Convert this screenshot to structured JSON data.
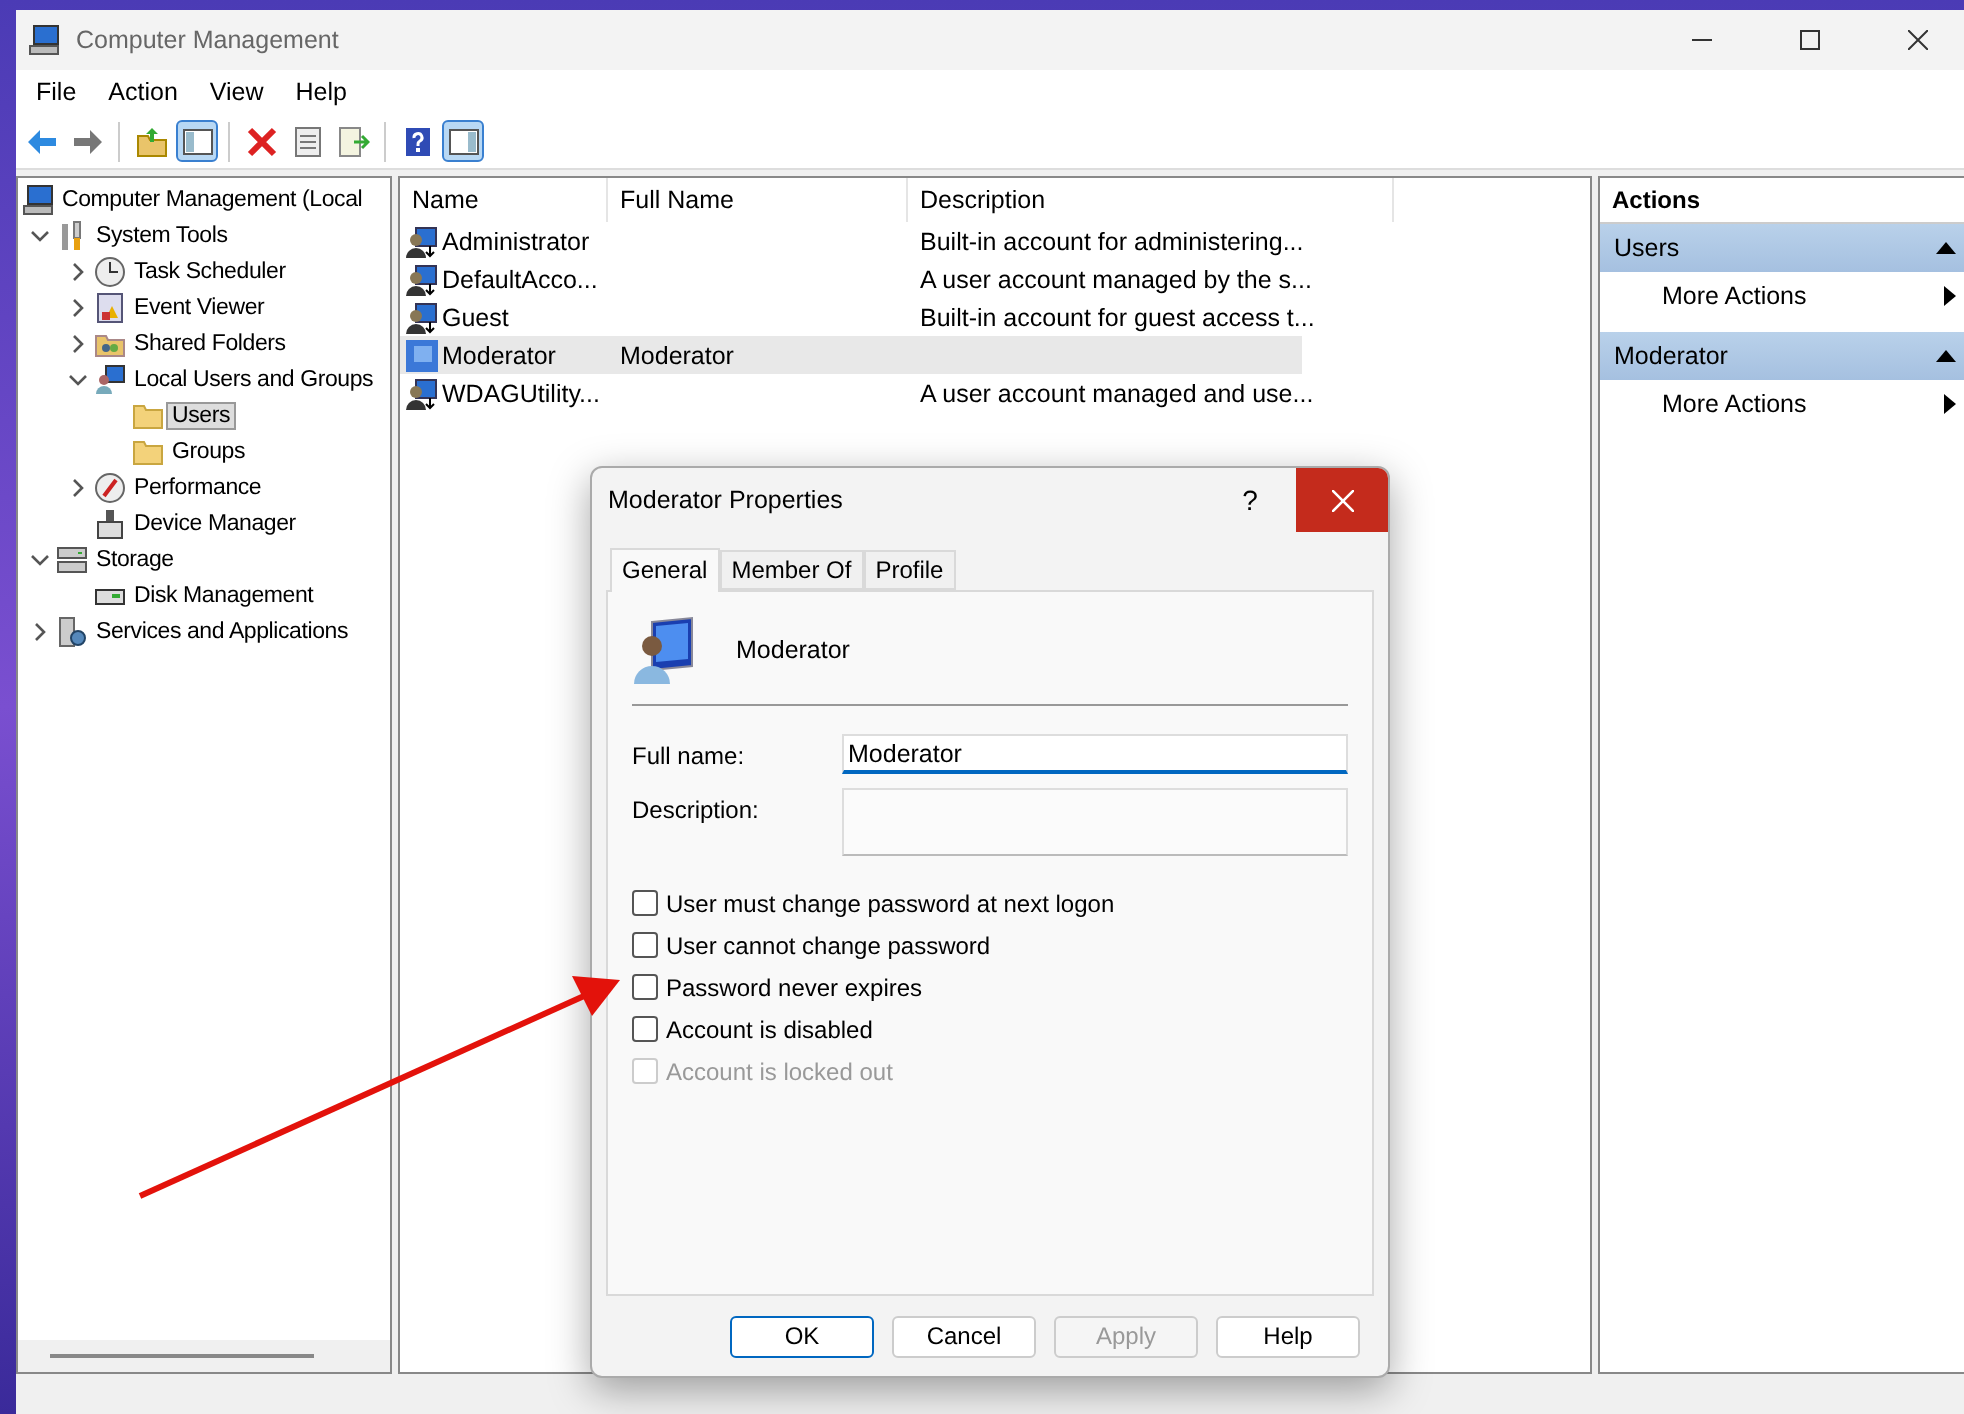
{
  "window": {
    "title": "Computer Management"
  },
  "menu": [
    "File",
    "Action",
    "View",
    "Help"
  ],
  "toolbar": [
    [
      {
        "kind": "back",
        "pressed": false
      },
      {
        "kind": "forward",
        "pressed": false
      }
    ],
    [
      {
        "kind": "up",
        "pressed": false
      },
      {
        "kind": "tree",
        "pressed": true
      }
    ],
    [
      {
        "kind": "delete",
        "pressed": false
      },
      {
        "kind": "properties",
        "pressed": false
      },
      {
        "kind": "export",
        "pressed": false
      }
    ],
    [
      {
        "kind": "help",
        "pressed": false
      },
      {
        "kind": "pane",
        "pressed": true
      }
    ]
  ],
  "tree": [
    {
      "label": "Computer Management (Local",
      "kind": "computer",
      "selected": false,
      "children": [
        {
          "label": "System Tools",
          "kind": "tools",
          "selected": false,
          "expanded": true,
          "children": [
            {
              "label": "Task Scheduler",
              "kind": "clock",
              "selected": false,
              "expanded": false
            },
            {
              "label": "Event Viewer",
              "kind": "log",
              "selected": false,
              "expanded": false
            },
            {
              "label": "Shared Folders",
              "kind": "share",
              "selected": false,
              "expanded": false
            },
            {
              "label": "Local Users and Groups",
              "kind": "users",
              "selected": false,
              "expanded": true,
              "children": [
                {
                  "label": "Users",
                  "kind": "folder",
                  "selected": true
                },
                {
                  "label": "Groups",
                  "kind": "folder",
                  "selected": false
                }
              ]
            },
            {
              "label": "Performance",
              "kind": "gauge",
              "selected": false,
              "expanded": false
            },
            {
              "label": "Device Manager",
              "kind": "device",
              "selected": false
            }
          ]
        },
        {
          "label": "Storage",
          "kind": "storage",
          "selected": false,
          "expanded": true,
          "children": [
            {
              "label": "Disk Management",
              "kind": "disk",
              "selected": false
            }
          ]
        },
        {
          "label": "Services and Applications",
          "kind": "services",
          "selected": false,
          "expanded": false
        }
      ]
    }
  ],
  "table": {
    "columns": [
      "Name",
      "Full Name",
      "Description"
    ],
    "rows": [
      {
        "name": "Administrator",
        "description": "Built-in account for administering...",
        "selected": false
      },
      {
        "name": "DefaultAcco...",
        "description": "A user account managed by the s...",
        "selected": false
      },
      {
        "name": "Guest",
        "description": "Built-in account for guest access t...",
        "selected": false
      },
      {
        "name": "Moderator",
        "full_name": "Moderator",
        "selected": true
      },
      {
        "name": "WDAGUtility...",
        "description": "A user account managed and use...",
        "selected": false
      }
    ]
  },
  "actions": {
    "title": "Actions",
    "sections": [
      {
        "title": "Users",
        "items": [
          "More Actions"
        ]
      },
      {
        "title": "Moderator",
        "items": [
          "More Actions"
        ]
      }
    ]
  },
  "dialog": {
    "title": "Moderator Properties",
    "help": "?",
    "tabs": [
      {
        "label": "General",
        "selected": true
      },
      {
        "label": "Member Of",
        "selected": false
      },
      {
        "label": "Profile",
        "selected": false
      }
    ],
    "user": "Moderator",
    "fields": [
      {
        "label": "Full name:",
        "value": "Moderator",
        "focused": true,
        "kind": "line"
      },
      {
        "label": "Description:",
        "focused": false,
        "kind": "area"
      }
    ],
    "checkboxes": [
      {
        "label": "User must change password at next logon",
        "checked": false,
        "disabled": false
      },
      {
        "label": "User cannot change password",
        "checked": false,
        "disabled": false
      },
      {
        "label": "Password never expires",
        "checked": false,
        "disabled": false
      },
      {
        "label": "Account is disabled",
        "checked": false,
        "disabled": false
      },
      {
        "label": "Account is locked out",
        "checked": false,
        "disabled": true
      }
    ],
    "buttons": [
      {
        "label": "OK",
        "default": true,
        "disabled": false
      },
      {
        "label": "Cancel",
        "default": false,
        "disabled": false
      },
      {
        "label": "Apply",
        "default": false,
        "disabled": true
      },
      {
        "label": "Help",
        "default": false,
        "disabled": false
      }
    ]
  }
}
